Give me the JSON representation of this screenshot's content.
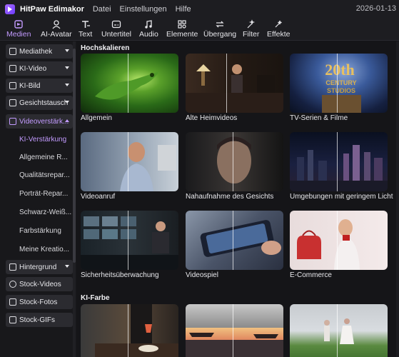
{
  "titlebar": {
    "app_name": "HitPaw Edimakor",
    "menus": [
      "Datei",
      "Einstellungen",
      "Hilfe"
    ],
    "date": "2026-01-13"
  },
  "toolbar": {
    "tabs": [
      {
        "label": "Medien",
        "icon": "media-icon",
        "active": true
      },
      {
        "label": "AI-Avatar",
        "icon": "avatar-icon",
        "active": false
      },
      {
        "label": "Text",
        "icon": "text-icon",
        "active": false
      },
      {
        "label": "Untertitel",
        "icon": "subtitle-icon",
        "active": false
      },
      {
        "label": "Audio",
        "icon": "audio-icon",
        "active": false
      },
      {
        "label": "Elemente",
        "icon": "elements-icon",
        "active": false
      },
      {
        "label": "Übergang",
        "icon": "transition-icon",
        "active": false
      },
      {
        "label": "Filter",
        "icon": "filter-icon",
        "active": false
      },
      {
        "label": "Effekte",
        "icon": "effects-icon",
        "active": false
      }
    ]
  },
  "sidebar": {
    "items": [
      {
        "label": "Mediathek",
        "icon": "folder-icon",
        "chevron": true
      },
      {
        "label": "KI-Video",
        "icon": "ai-video-icon",
        "chevron": true
      },
      {
        "label": "KI-Bild",
        "icon": "ai-image-icon",
        "chevron": true
      },
      {
        "label": "Gesichtstausch",
        "icon": "face-swap-icon",
        "chevron": true
      },
      {
        "label": "Videoverstärk...",
        "icon": "video-enhance-icon",
        "chevron": true,
        "open": true
      },
      {
        "label": "Hintergrund",
        "icon": "background-icon",
        "chevron": true
      },
      {
        "label": "Stock-Videos",
        "icon": "stock-video-icon",
        "chevron": false
      },
      {
        "label": "Stock-Fotos",
        "icon": "stock-photo-icon",
        "chevron": false
      },
      {
        "label": "Stock-GIFs",
        "icon": "stock-gif-icon",
        "chevron": false
      }
    ],
    "subitems": [
      {
        "label": "KI-Verstärkung",
        "selected": true
      },
      {
        "label": "Allgemeine R...",
        "selected": false
      },
      {
        "label": "Qualitätsrepar...",
        "selected": false
      },
      {
        "label": "Porträt-Repar...",
        "selected": false
      },
      {
        "label": "Schwarz-Weiß...",
        "selected": false
      },
      {
        "label": "Farbstärkung",
        "selected": false
      },
      {
        "label": "Meine Kreatio...",
        "selected": false
      }
    ]
  },
  "content": {
    "sections": [
      {
        "title": "Hochskalieren",
        "cards": [
          {
            "label": "Allgemein"
          },
          {
            "label": "Alte Heimvideos"
          },
          {
            "label": "TV-Serien & Filme"
          },
          {
            "label": "Videoanruf"
          },
          {
            "label": "Nahaufnahme des Gesichts"
          },
          {
            "label": "Umgebungen mit geringem Licht"
          },
          {
            "label": "Sicherheitsüberwachung"
          },
          {
            "label": "Videospiel"
          },
          {
            "label": "E-Commerce"
          }
        ]
      },
      {
        "title": "KI-Farbe",
        "cards": [
          {
            "label": ""
          },
          {
            "label": ""
          },
          {
            "label": ""
          }
        ]
      }
    ]
  },
  "thumbnail_text": {
    "studio_logo_lines": [
      "20th",
      "CENTURY",
      "STUDIOS"
    ]
  },
  "colors": {
    "accent": "#c39bff",
    "background": "#151518",
    "sidebar_item": "#2b2b30"
  }
}
